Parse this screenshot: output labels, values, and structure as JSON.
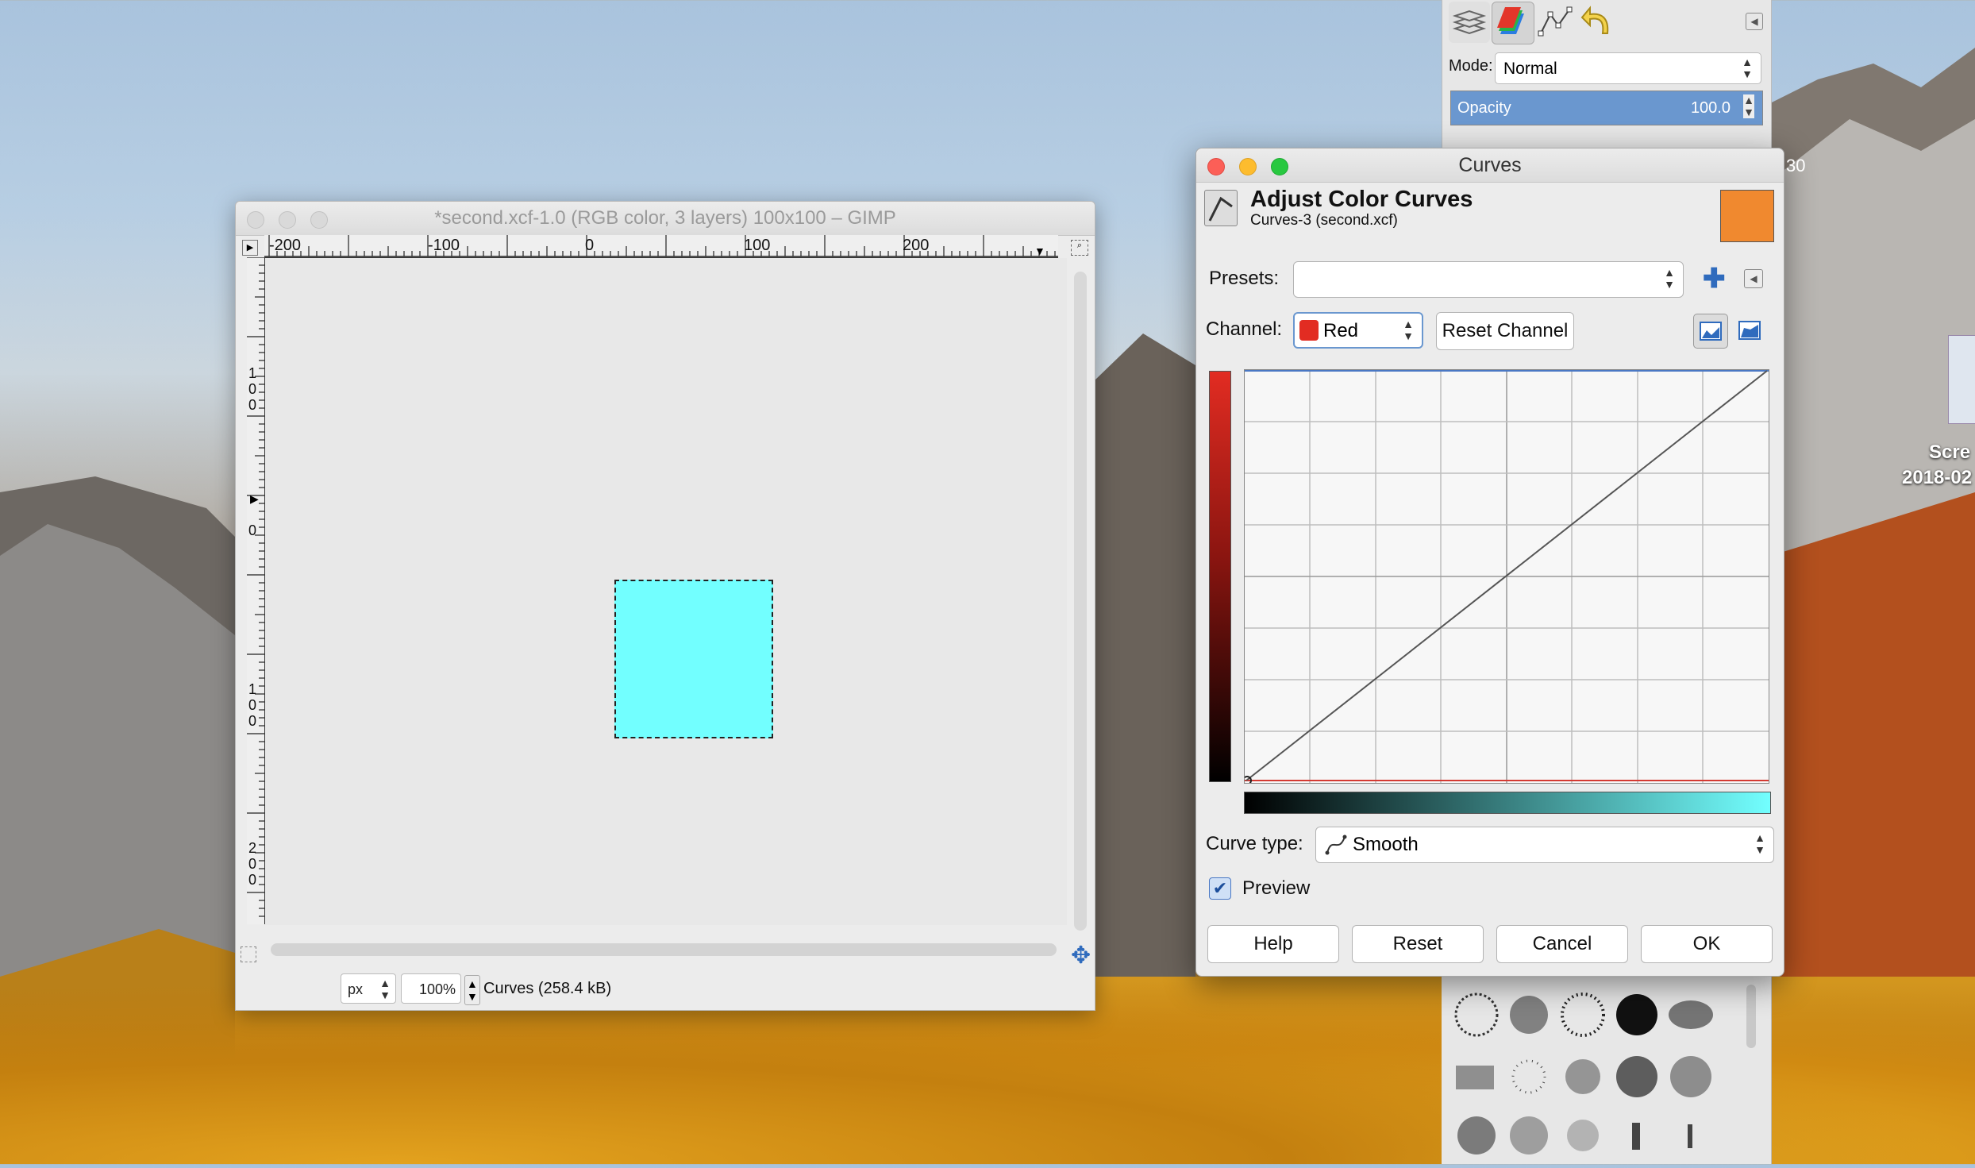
{
  "image_window": {
    "title": "*second.xcf-1.0 (RGB color, 3 layers) 100x100 – GIMP",
    "ruler_h_ticks": [
      "-200",
      "-100",
      "0",
      "100",
      "200"
    ],
    "ruler_v_ticks": [
      "1\n0\n0",
      "0",
      "1\n0\n0",
      "2\n0\n0"
    ],
    "unit": "px",
    "zoom": "100%",
    "status": "Curves (258.4 kB)"
  },
  "dock": {
    "mode_label": "Mode:",
    "mode_value": "Normal",
    "opacity_label": "Opacity",
    "opacity_value": "100.0",
    "tabs": [
      "layers-icon",
      "channels-icon",
      "paths-icon",
      "undo-icon"
    ]
  },
  "curves_dialog": {
    "window_title": "Curves",
    "heading": "Adjust Color Curves",
    "subheading": "Curves-3 (second.xcf)",
    "color_swatch": "#f0892f",
    "presets_label": "Presets:",
    "presets_value": "",
    "channel_label": "Channel:",
    "channel_value": "Red",
    "reset_channel": "Reset Channel",
    "curve_type_label": "Curve type:",
    "curve_type_value": "Smooth",
    "preview_label": "Preview",
    "preview_checked": true,
    "buttons": {
      "help": "Help",
      "reset": "Reset",
      "cancel": "Cancel",
      "ok": "OK"
    }
  },
  "desktop": {
    "file_label_1": "Scre",
    "file_label_2": "2018-02",
    "partial_text": "30"
  },
  "colors": {
    "canvas_fill": "#72ffff",
    "accent": "#6a97cf",
    "close": "#fc5f57",
    "minimize": "#fdbc2e",
    "zoom": "#28c840"
  }
}
